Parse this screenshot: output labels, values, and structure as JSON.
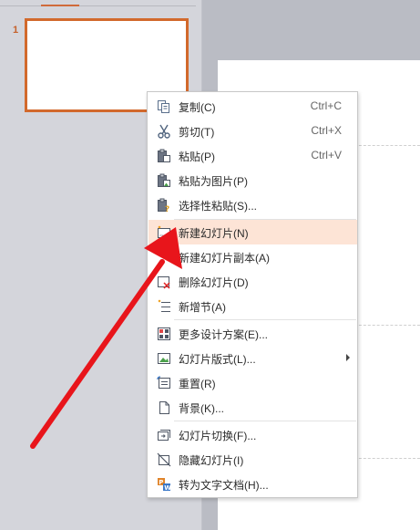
{
  "thumbnails": {
    "slide_number": "1"
  },
  "context_menu": {
    "items": [
      {
        "label": "复制(C)",
        "shortcut": "Ctrl+C",
        "icon": "copy-icon"
      },
      {
        "label": "剪切(T)",
        "shortcut": "Ctrl+X",
        "icon": "scissors-icon"
      },
      {
        "label": "粘贴(P)",
        "shortcut": "Ctrl+V",
        "icon": "paste-icon"
      },
      {
        "label": "粘贴为图片(P)",
        "shortcut": "",
        "icon": "paste-as-picture-icon"
      },
      {
        "label": "选择性粘贴(S)...",
        "shortcut": "",
        "icon": "paste-special-icon"
      },
      {
        "label": "新建幻灯片(N)",
        "shortcut": "",
        "icon": "new-slide-icon",
        "highlighted": true
      },
      {
        "label": "新建幻灯片副本(A)",
        "shortcut": "",
        "icon": "duplicate-slide-icon"
      },
      {
        "label": "删除幻灯片(D)",
        "shortcut": "",
        "icon": "delete-slide-icon"
      },
      {
        "label": "新增节(A)",
        "shortcut": "",
        "icon": "add-section-icon"
      },
      {
        "label": "更多设计方案(E)...",
        "shortcut": "",
        "icon": "design-scheme-icon"
      },
      {
        "label": "幻灯片版式(L)...",
        "shortcut": "",
        "icon": "slide-layout-icon",
        "submenu": true
      },
      {
        "label": "重置(R)",
        "shortcut": "",
        "icon": "reset-icon"
      },
      {
        "label": "背景(K)...",
        "shortcut": "",
        "icon": "background-icon"
      },
      {
        "label": "幻灯片切换(F)...",
        "shortcut": "",
        "icon": "slide-transition-icon"
      },
      {
        "label": "隐藏幻灯片(I)",
        "shortcut": "",
        "icon": "hide-slide-icon"
      },
      {
        "label": "转为文字文档(H)...",
        "shortcut": "",
        "icon": "convert-to-document-icon"
      }
    ]
  },
  "colors": {
    "accent": "#d2692c",
    "highlight": "#fde4d6",
    "annotation_arrow": "#e8151b"
  }
}
